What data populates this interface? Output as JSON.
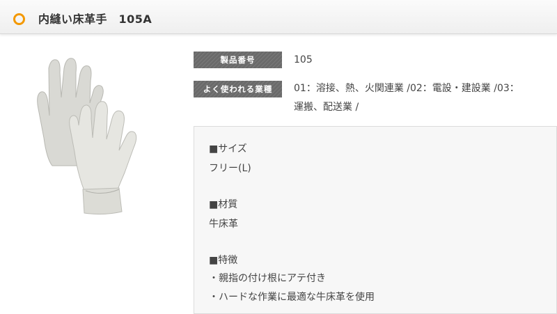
{
  "title": {
    "icon": "ring-icon",
    "icon_color": "#f39800",
    "text": "内縫い床革手　105A"
  },
  "product_image": {
    "icon": "leather-gloves-image",
    "alt": "内縫い床革手"
  },
  "specs": {
    "product_number": {
      "label": "製品番号",
      "value": "105"
    },
    "industries": {
      "label": "よく使われる業種",
      "value_line1": "01：溶接、熱、火関連業 /02：電設・建設業 /03：",
      "value_line2": "運搬、配送業 /"
    }
  },
  "details": {
    "size_heading": "■サイズ",
    "size_value": "フリー(L)",
    "material_heading": "■材質",
    "material_value": "牛床革",
    "features_heading": "■特徴",
    "feature_1": "・親指の付け根にアテ付き",
    "feature_2": "・ハードな作業に最適な牛床革を使用"
  }
}
